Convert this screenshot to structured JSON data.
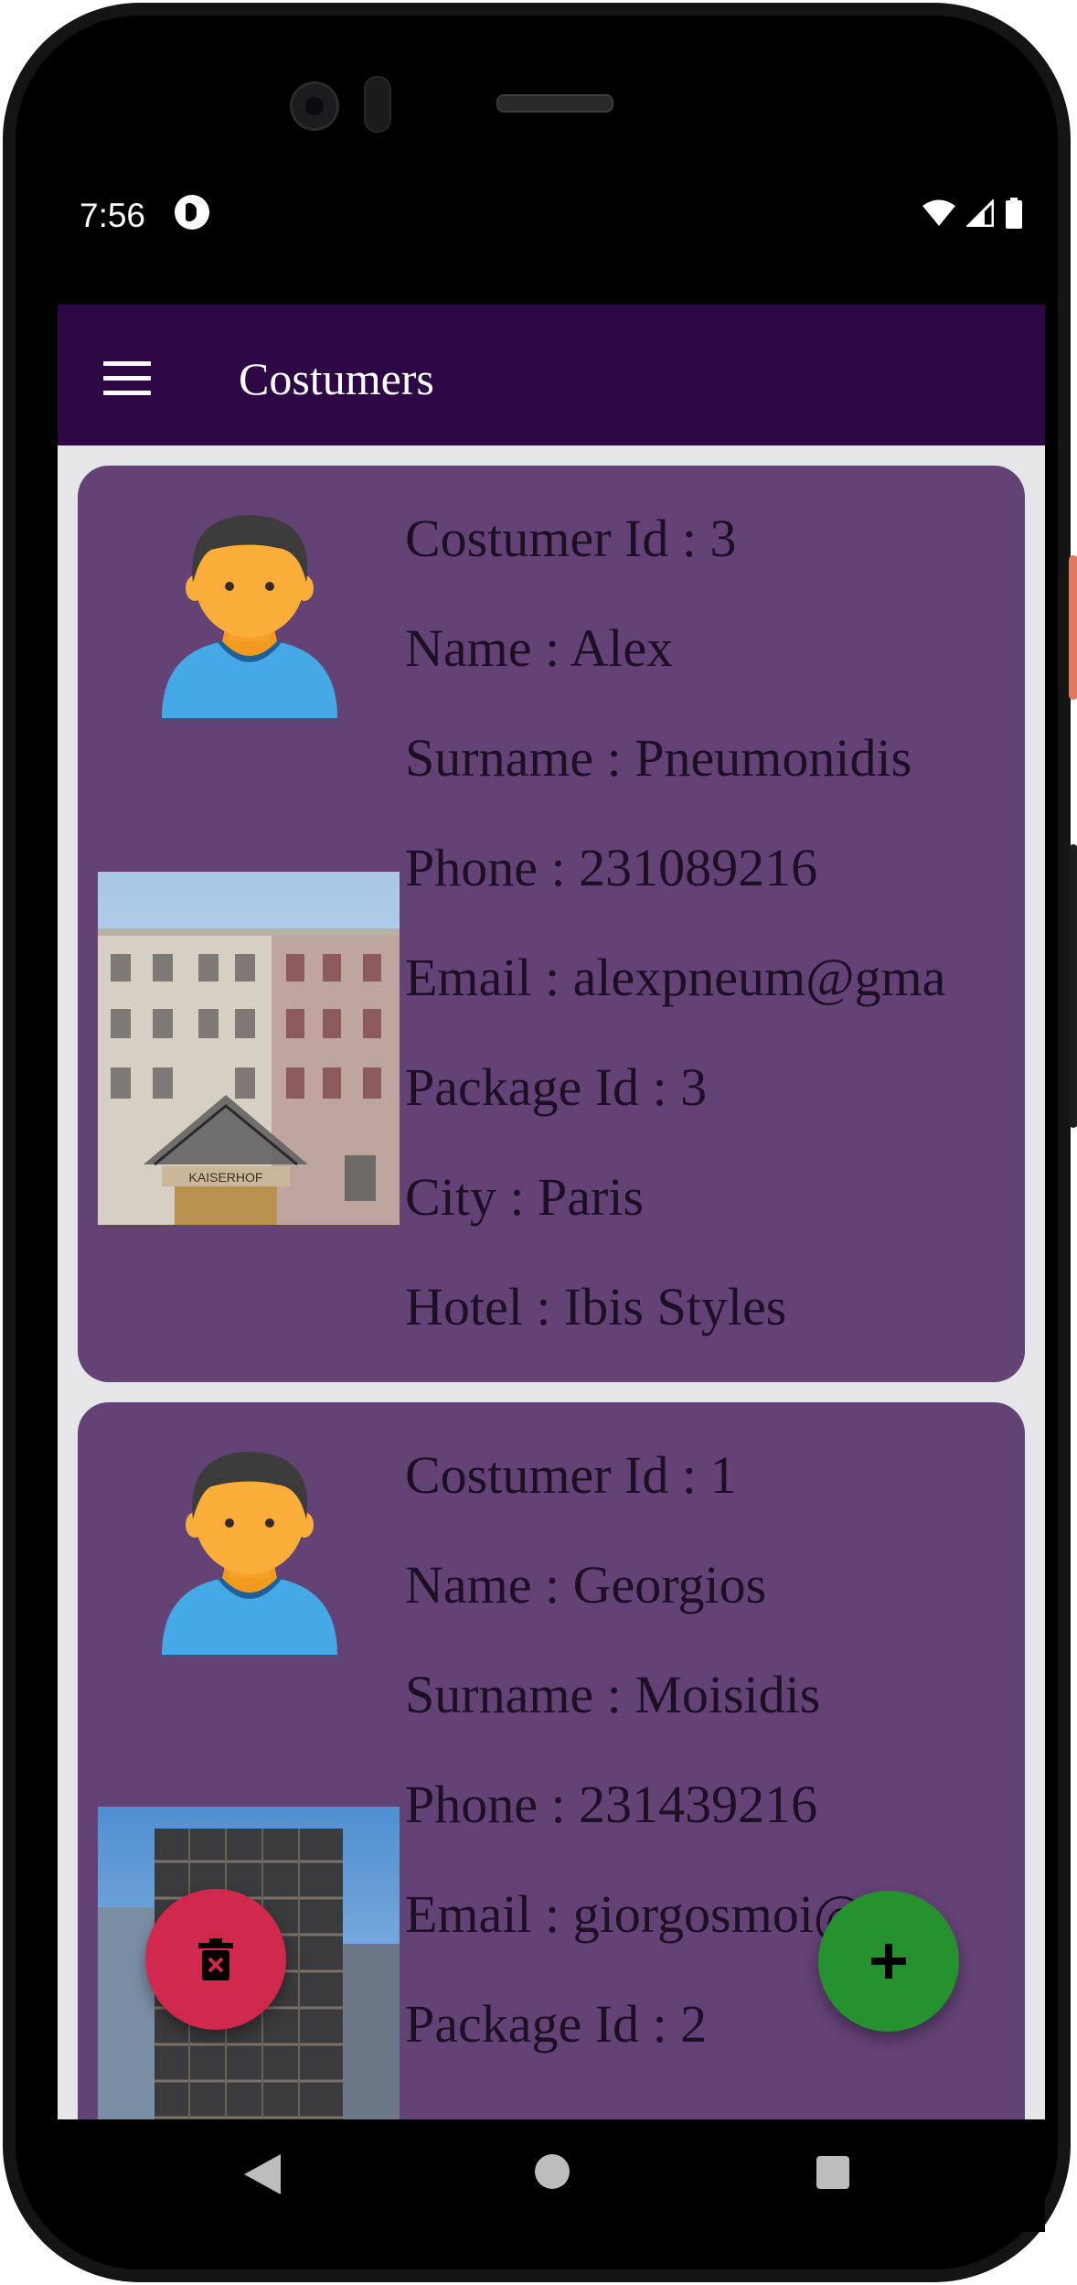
{
  "status_bar": {
    "time": "7:56",
    "icons": [
      "app-notification-icon",
      "wifi-icon",
      "cell-signal-icon",
      "battery-icon"
    ]
  },
  "app_bar": {
    "title": "Costumers",
    "menu_icon": "hamburger-menu-icon"
  },
  "colors": {
    "app_bar": "#2d0845",
    "card": "#634276",
    "background": "#e6e5e7",
    "fab_delete": "#d1294d",
    "fab_add": "#26922f"
  },
  "customers": [
    {
      "id": "Costumer Id : 3",
      "name": "Name : Alex",
      "surname": "Surname : Pneumonidis",
      "phone": "Phone : 231089216",
      "email": "Email : alexpneum@gma",
      "package": "Package Id : 3",
      "city": "City : Paris",
      "hotel": "Hotel : Ibis Styles",
      "photo_sign": "KAISERHOF"
    },
    {
      "id": "Costumer Id : 1",
      "name": "Name : Georgios",
      "surname": "Surname : Moisidis",
      "phone": "Phone : 231439216",
      "email": "Email : giorgosmoi@gm",
      "package": "Package Id : 2"
    }
  ],
  "fabs": {
    "delete_icon": "trash-delete-icon",
    "add_icon": "plus-icon"
  },
  "nav": {
    "icons": [
      "back-triangle-icon",
      "home-circle-icon",
      "recents-square-icon"
    ]
  }
}
